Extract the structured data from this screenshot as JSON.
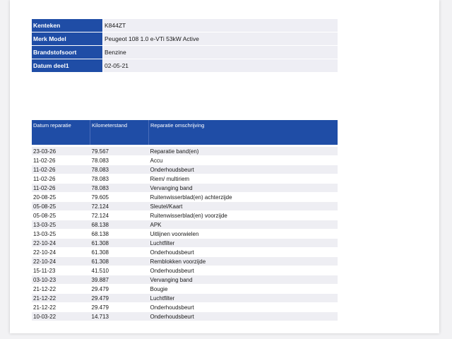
{
  "vehicle": {
    "rows": [
      {
        "label": "Kenteken",
        "value": "K844ZT"
      },
      {
        "label": "Merk Model",
        "value": "Peugeot 108 1.0 e-VTi 53kW Active"
      },
      {
        "label": "Brandstofsoort",
        "value": "Benzine"
      },
      {
        "label": "Datum deel1",
        "value": "02-05-21"
      }
    ]
  },
  "history": {
    "headers": [
      "Datum reparatie",
      "Kilometerstand",
      "Reparatie omschrijving"
    ],
    "rows": [
      [
        "23-03-26",
        "79.567",
        "Reparatie band(en)"
      ],
      [
        "11-02-26",
        "78.083",
        "Accu"
      ],
      [
        "11-02-26",
        "78.083",
        "Onderhoudsbeurt"
      ],
      [
        "11-02-26",
        "78.083",
        "Riem/ multiriem"
      ],
      [
        "11-02-26",
        "78.083",
        "Vervanging band"
      ],
      [
        "20-08-25",
        "79.605",
        "Ruitenwisserblad(en) achterzijde"
      ],
      [
        "05-08-25",
        "72.124",
        "Sleutel/Kaart"
      ],
      [
        "05-08-25",
        "72.124",
        "Ruitenwisserblad(en) voorzijde"
      ],
      [
        "13-03-25",
        "68.138",
        "APK"
      ],
      [
        "13-03-25",
        "68.138",
        "Uitlijnen voorwielen"
      ],
      [
        "22-10-24",
        "61.308",
        "Luchtfilter"
      ],
      [
        "22-10-24",
        "61.308",
        "Onderhoudsbeurt"
      ],
      [
        "22-10-24",
        "61.308",
        "Remblokken voorzijde"
      ],
      [
        "15-11-23",
        "41.510",
        "Onderhoudsbeurt"
      ],
      [
        "03-10-23",
        "39.887",
        "Vervanging band"
      ],
      [
        "21-12-22",
        "29.479",
        "Bougie"
      ],
      [
        "21-12-22",
        "29.479",
        "Luchtfilter"
      ],
      [
        "21-12-22",
        "29.479",
        "Onderhoudsbeurt"
      ],
      [
        "10-03-22",
        "14.713",
        "Onderhoudsbeurt"
      ]
    ]
  }
}
